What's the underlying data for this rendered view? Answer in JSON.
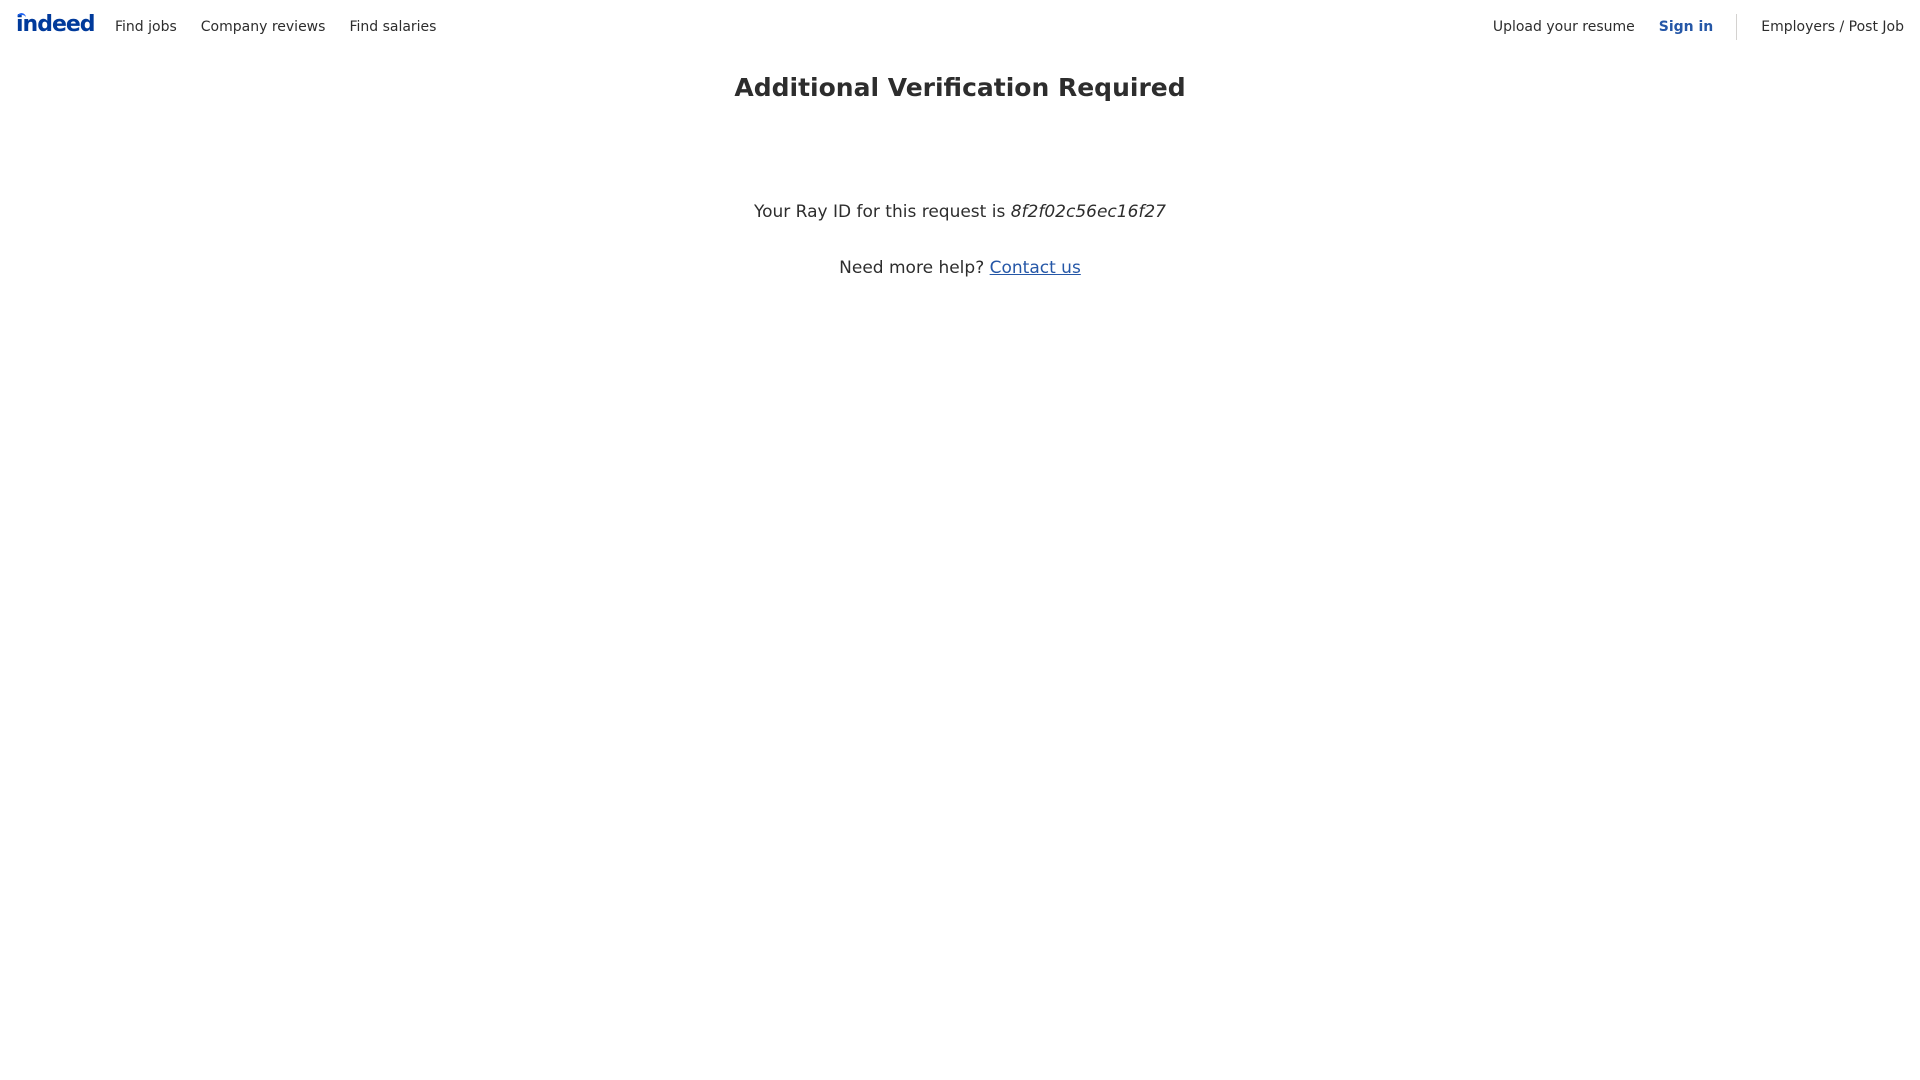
{
  "header": {
    "logo_text": "indeed",
    "nav_left": [
      {
        "label": "Find jobs"
      },
      {
        "label": "Company reviews"
      },
      {
        "label": "Find salaries"
      }
    ],
    "upload_label": "Upload your resume",
    "signin_label": "Sign in",
    "employers_label": "Employers / Post Job"
  },
  "main": {
    "title": "Additional Verification Required",
    "ray_prefix": "Your Ray ID for this request is",
    "ray_id": "8f2f02c56ec16f27",
    "help_prefix": "Need more help?",
    "contact_label": "Contact us"
  },
  "colors": {
    "brand": "#003a9b",
    "link": "#2557a7",
    "text": "#2d2d2d"
  },
  "icons": {
    "logo": "indeed-logo"
  }
}
